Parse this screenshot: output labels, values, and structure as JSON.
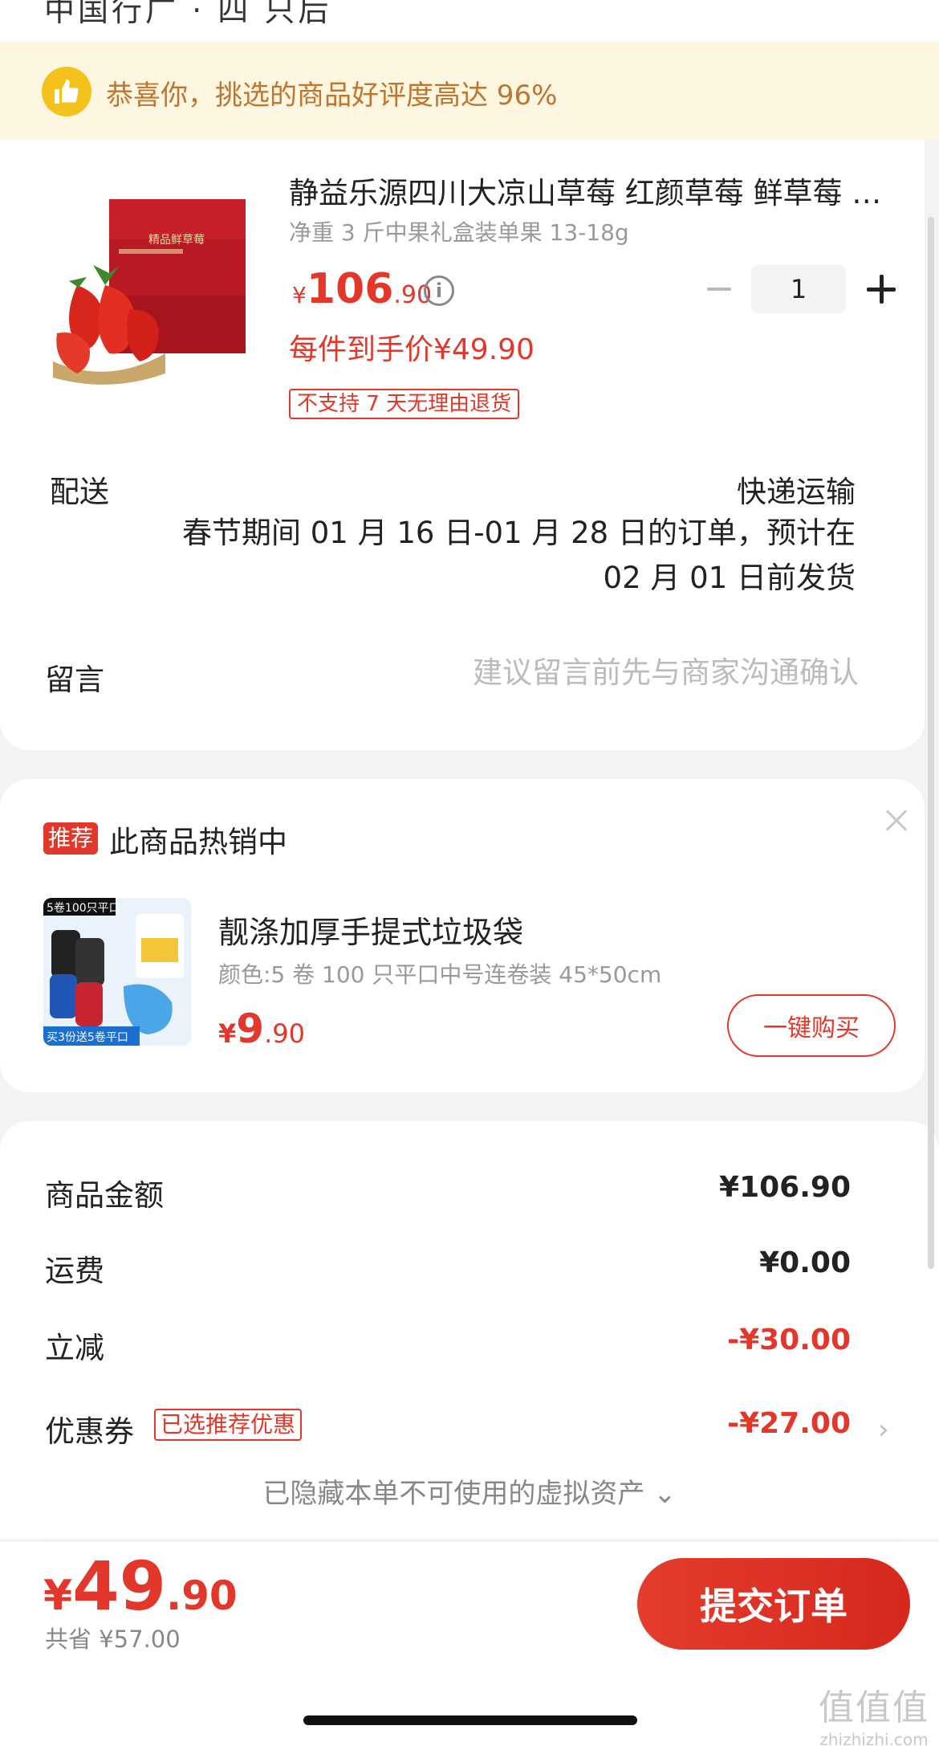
{
  "header": {
    "cut_text": "中国行广  · 四 只后"
  },
  "banner": {
    "text": "恭喜你，挑选的商品好评度高达 96%",
    "icon": "thumbs-up-icon",
    "accent": "#f5c21b"
  },
  "product": {
    "title": "静益乐源四川大凉山草莓 红颜草莓 鲜草莓 新鲜水果",
    "spec": "净重 3 斤中果礼盒装单果 13-18g",
    "price_yen": "¥",
    "price_int": "106",
    "price_dec": ".90",
    "info_icon": "i",
    "per_item_price": "每件到手价¥49.90",
    "return_policy": "不支持 7 天无理由退货",
    "quantity": "1",
    "box_text": "精品鲜草莓"
  },
  "shipping": {
    "label": "配送",
    "value": "快递运输",
    "note": "春节期间 01 月 16 日-01 月 28 日的订单，预计在 02 月 01 日前发货"
  },
  "message": {
    "label": "留言",
    "placeholder": "建议留言前先与商家沟通确认"
  },
  "recommend": {
    "tag": "推荐",
    "title": "此商品热销中",
    "item_name": "靓涤加厚手提式垃圾袋",
    "item_spec": "颜色:5 卷 100 只平口中号连卷装 45*50cm",
    "price_yen": "¥",
    "price_int": "9",
    "price_dec": ".90",
    "buy_label": "一键购买",
    "img_top": "5卷100只平口",
    "img_bottom": "买3份送5卷平口"
  },
  "summary": {
    "goods_label": "商品金额",
    "goods_value": "¥106.90",
    "freight_label": "运费",
    "freight_value": "¥0.00",
    "discount_label": "立减",
    "discount_value": "-¥30.00",
    "coupon_label": "优惠券",
    "coupon_tag": "已选推荐优惠",
    "coupon_value": "-¥27.00",
    "hidden_text": "已隐藏本单不可使用的虚拟资产 ⌄"
  },
  "footer": {
    "total_yen": "¥",
    "total_int": "49",
    "total_dec": ".90",
    "saved": "共省 ¥57.00",
    "submit_label": "提交订单"
  },
  "watermark": {
    "line1": "值值值",
    "line2": "zhizhizhi.com"
  },
  "colors": {
    "accent_red": "#e2372a",
    "banner_bg": "#fdf6e1",
    "banner_text": "#c0752f"
  }
}
